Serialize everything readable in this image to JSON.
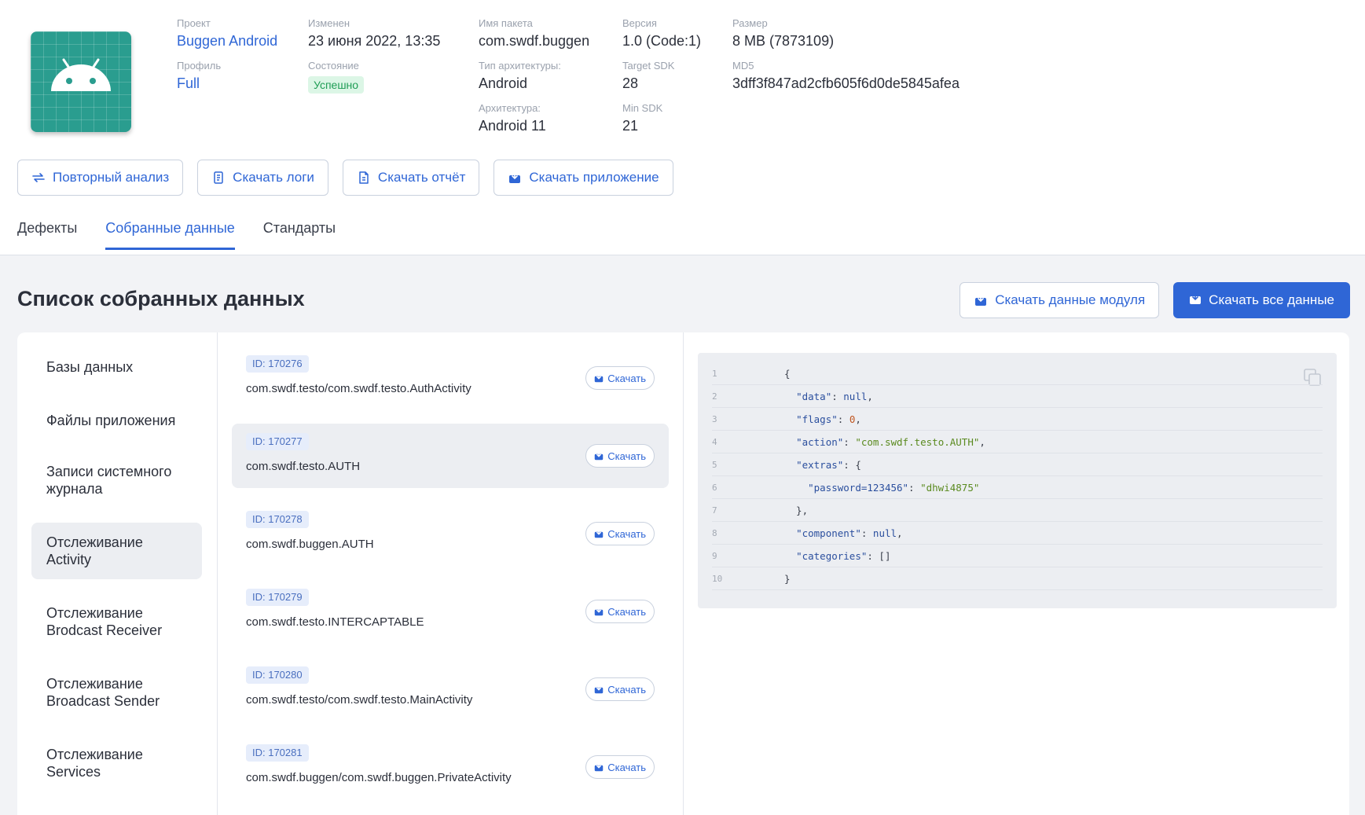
{
  "project": {
    "fields": [
      {
        "label": "Проект",
        "value": "Buggen Android"
      },
      {
        "label": "Изменен",
        "value": "23 июня 2022, 13:35"
      },
      {
        "label": "Имя пакета",
        "value": "com.swdf.buggen"
      },
      {
        "label": "Версия",
        "value": "1.0 (Code:1)"
      },
      {
        "label": "Размер",
        "value": "8 MB (7873109)"
      },
      {
        "label": "Профиль",
        "value": "Full"
      },
      {
        "label": "Состояние",
        "value": "Успешно"
      },
      {
        "label": "Тип архитектуры:",
        "value": "Android"
      },
      {
        "label": "Target SDK",
        "value": "28"
      },
      {
        "label": "MD5",
        "value": "3dff3f847ad2cfb605f6d0de5845afea"
      },
      {
        "label": "Архитектура:",
        "value": "Android 11"
      },
      {
        "label": "Min SDK",
        "value": "21"
      }
    ]
  },
  "actions": {
    "reanalyze": "Повторный анализ",
    "download_logs": "Скачать логи",
    "download_report": "Скачать отчёт",
    "download_app": "Скачать приложение"
  },
  "tabs": [
    "Дефекты",
    "Собранные данные",
    "Стандарты"
  ],
  "page": {
    "title": "Список собранных данных",
    "download_module": "Скачать данные модуля",
    "download_all": "Скачать все данные"
  },
  "sidebar": {
    "items": [
      "Базы данных",
      "Файлы приложения",
      "Записи системного журнала",
      "Отслеживание Activity",
      "Отслеживание Brodcast Receiver",
      "Отслеживание Broadcast Sender",
      "Отслеживание Services"
    ]
  },
  "list": {
    "download_label": "Скачать",
    "items": [
      {
        "id": "ID: 170276",
        "path": "com.swdf.testo/com.swdf.testo.AuthActivity"
      },
      {
        "id": "ID: 170277",
        "path": "com.swdf.testo.AUTH"
      },
      {
        "id": "ID: 170278",
        "path": "com.swdf.buggen.AUTH"
      },
      {
        "id": "ID: 170279",
        "path": "com.swdf.testo.INTERCAPTABLE"
      },
      {
        "id": "ID: 170280",
        "path": "com.swdf.testo/com.swdf.testo.MainActivity"
      },
      {
        "id": "ID: 170281",
        "path": "com.swdf.buggen/com.swdf.buggen.PrivateActivity"
      }
    ]
  },
  "code": {
    "lines": [
      {
        "n": "1",
        "t": "{"
      },
      {
        "n": "2",
        "t": "  \"data\": null,"
      },
      {
        "n": "3",
        "t": "  \"flags\": 0,"
      },
      {
        "n": "4",
        "t": "  \"action\": \"com.swdf.testo.AUTH\","
      },
      {
        "n": "5",
        "t": "  \"extras\": {"
      },
      {
        "n": "6",
        "t": "    \"password=123456\": \"dhwi4875\""
      },
      {
        "n": "7",
        "t": "  },"
      },
      {
        "n": "8",
        "t": "  \"component\": null,"
      },
      {
        "n": "9",
        "t": "  \"categories\": []"
      },
      {
        "n": "10",
        "t": "}"
      }
    ]
  },
  "colors": {
    "accent": "#2f66d6",
    "success": "#1f9d55",
    "icon_bg": "#2a9d8f"
  }
}
